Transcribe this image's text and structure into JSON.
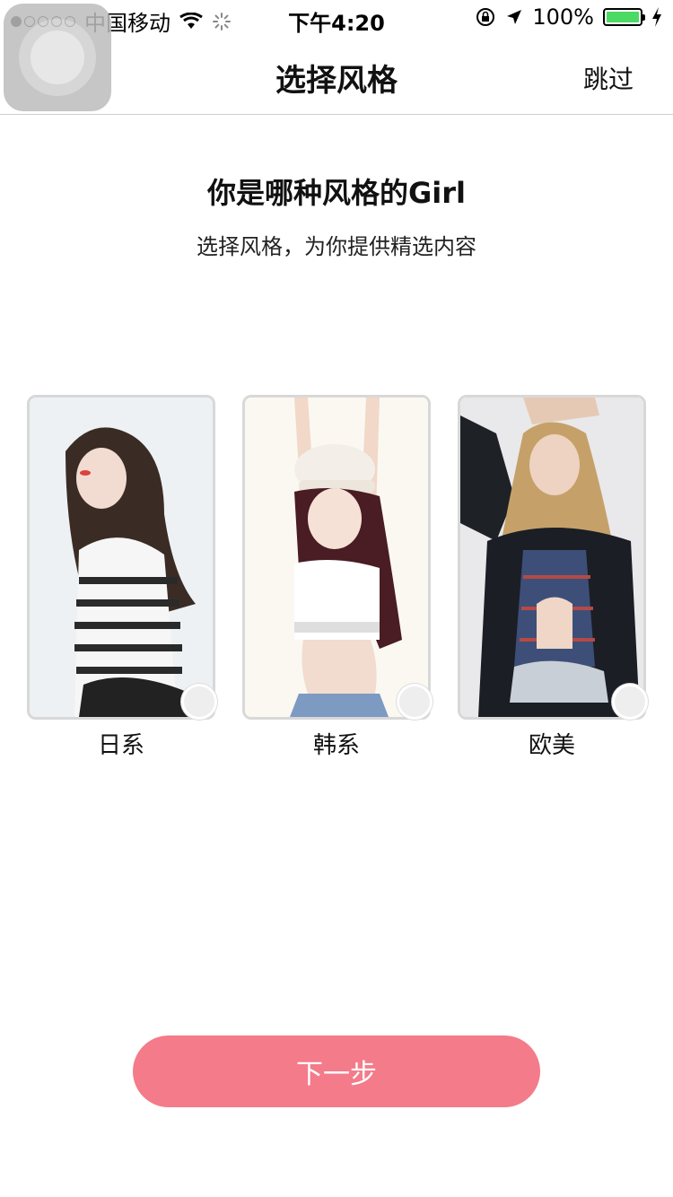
{
  "status_bar": {
    "carrier": "中国移动",
    "time": "下午4:20",
    "battery_percent": "100%",
    "battery_color": "#4cd964"
  },
  "nav": {
    "title": "选择风格",
    "skip_label": "跳过"
  },
  "heading": {
    "title": "你是哪种风格的Girl",
    "subtitle": "选择风格，为你提供精选内容"
  },
  "styles": [
    {
      "label": "日系",
      "selected": false,
      "icon": "photo-japanese-style"
    },
    {
      "label": "韩系",
      "selected": false,
      "icon": "photo-korean-style"
    },
    {
      "label": "欧美",
      "selected": false,
      "icon": "photo-western-style"
    }
  ],
  "next_button": {
    "label": "下一步",
    "color": "#f47b8a"
  }
}
